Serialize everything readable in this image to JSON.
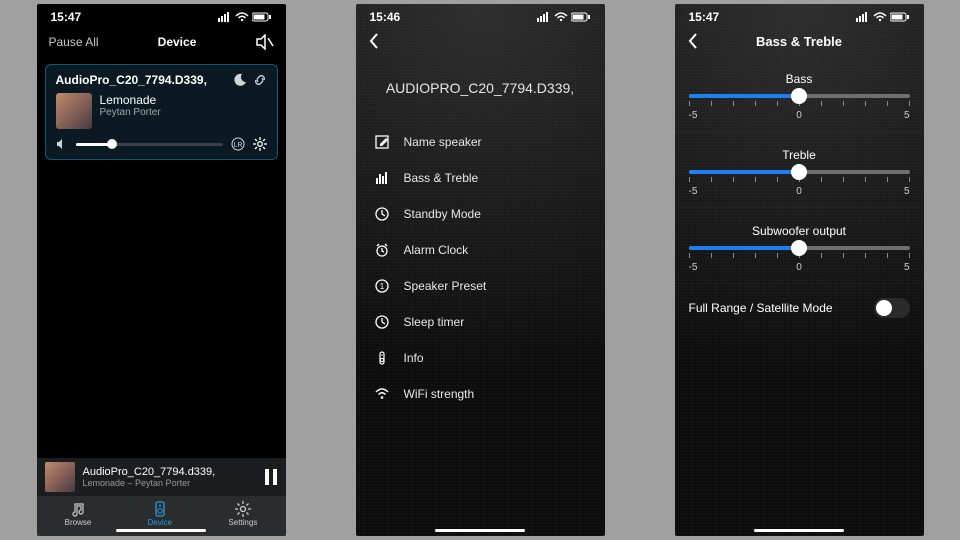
{
  "phone1": {
    "status": {
      "time": "15:47"
    },
    "header": {
      "pause_all": "Pause All",
      "title": "Device"
    },
    "card": {
      "device_name": "AudioPro_C20_7794.D339,",
      "song": "Lemonade",
      "artist": "Peytan Porter",
      "volume_pct": 25
    },
    "miniplayer": {
      "line1": "AudioPro_C20_7794.d339,",
      "line2": "Lemonade – Peytan Porter"
    },
    "tabs": {
      "browse": "Browse",
      "device": "Device",
      "settings": "Settings",
      "active": "device"
    }
  },
  "phone2": {
    "status": {
      "time": "15:46"
    },
    "device_name": "AUDIOPRO_C20_7794.D339,",
    "menu": [
      {
        "icon": "edit-icon",
        "label": "Name speaker"
      },
      {
        "icon": "eq-icon",
        "label": "Bass & Treble"
      },
      {
        "icon": "clock-icon",
        "label": "Standby Mode"
      },
      {
        "icon": "alarm-icon",
        "label": "Alarm Clock"
      },
      {
        "icon": "preset-icon",
        "label": "Speaker Preset"
      },
      {
        "icon": "sleep-icon",
        "label": "Sleep timer"
      },
      {
        "icon": "info-icon",
        "label": "Info"
      },
      {
        "icon": "wifi-icon",
        "label": "WiFi strength"
      }
    ]
  },
  "phone3": {
    "status": {
      "time": "15:47"
    },
    "title": "Bass & Treble",
    "sliders": {
      "bass": {
        "label": "Bass",
        "min": -5,
        "max": 5,
        "value": 0
      },
      "treble": {
        "label": "Treble",
        "min": -5,
        "max": 5,
        "value": 0
      },
      "sub": {
        "label": "Subwoofer output",
        "min": -5,
        "max": 5,
        "value": 0
      }
    },
    "tick_labels": {
      "min": "-5",
      "mid": "0",
      "max": "5"
    },
    "toggle": {
      "label": "Full Range / Satellite Mode",
      "on": false
    }
  }
}
